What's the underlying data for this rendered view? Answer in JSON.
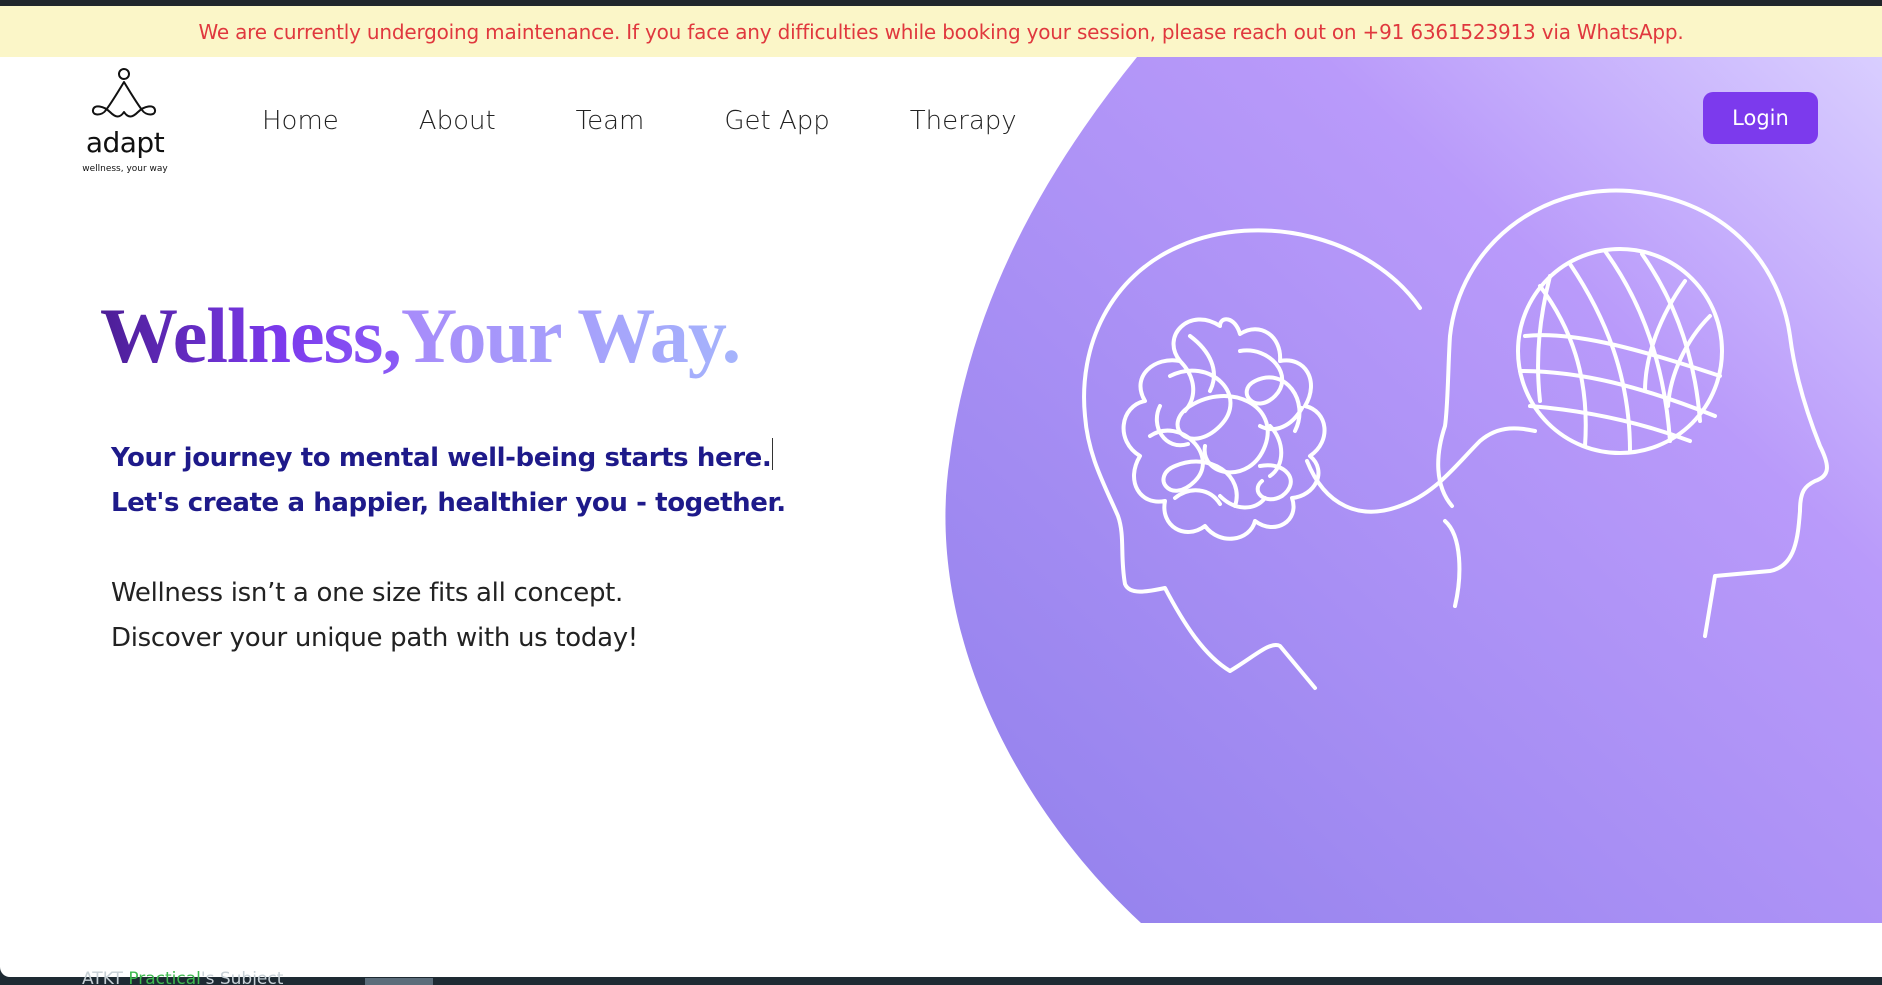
{
  "banner": {
    "message": "We are currently undergoing maintenance. If you face any difficulties while booking your session, please reach out on +91 6361523913 via WhatsApp."
  },
  "logo": {
    "wordmark": "adapt",
    "tagline": "wellness, your way"
  },
  "nav": {
    "items": [
      {
        "label": "Home"
      },
      {
        "label": "About"
      },
      {
        "label": "Team"
      },
      {
        "label": "Get App"
      },
      {
        "label": "Therapy"
      }
    ]
  },
  "header": {
    "login_label": "Login"
  },
  "hero": {
    "headline_part1": "Wellness,",
    "headline_part2": "Your Way.",
    "tagline_line1": "Your journey to mental well-being starts here.",
    "tagline_line2": "Let's create a happier, healthier you - together.",
    "desc_line1": "Wellness isn’t a one size fits all concept.",
    "desc_line2": "Discover your unique path with us today!",
    "illustration_icon": "two-heads-tangled-yarn-illustration"
  },
  "background_window": {
    "text_prefix": "ATKT ",
    "text_highlight": "Practical",
    "text_suffix": "'s Subject"
  },
  "colors": {
    "banner_bg": "#fbf6c8",
    "banner_text": "#e0383e",
    "accent": "#7c3aed",
    "tagline": "#1e1a8a",
    "hero_purple_light": "#c4b5fd",
    "hero_purple_dark": "#9381ed"
  }
}
